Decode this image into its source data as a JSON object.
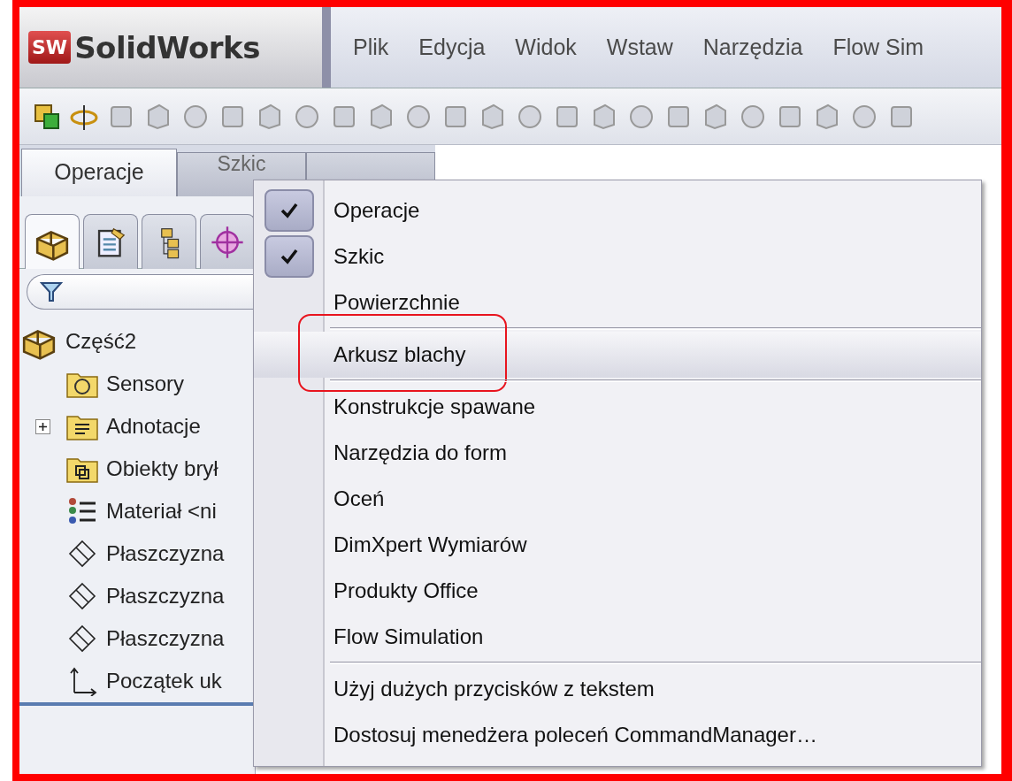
{
  "title_bar": {
    "logo_badge": "SW",
    "logo": "SolidWorks"
  },
  "menu_bar": [
    "Plik",
    "Edycja",
    "Widok",
    "Wstaw",
    "Narzędzia",
    "Flow Sim"
  ],
  "command_tabs": [
    {
      "label": "Operacje",
      "selected": true
    },
    {
      "label": "Szkic",
      "selected": false
    }
  ],
  "panel_tabs": [
    {
      "kind": "feature-tree",
      "selected": true
    },
    {
      "kind": "properties",
      "selected": false
    },
    {
      "kind": "configurations",
      "selected": false
    },
    {
      "kind": "display",
      "selected": false
    }
  ],
  "tree": {
    "label": "Część2",
    "children": [
      {
        "label": "Sensory",
        "kind": "sensor-folder"
      },
      {
        "label": "Adnotacje",
        "kind": "annotation-folder",
        "expanded": false
      },
      {
        "label": "Obiekty brył",
        "kind": "body-folder"
      },
      {
        "label": "Materiał <ni",
        "kind": "material"
      },
      {
        "label": "Płaszczyzna",
        "kind": "plane"
      },
      {
        "label": "Płaszczyzna",
        "kind": "plane"
      },
      {
        "label": "Płaszczyzna",
        "kind": "plane"
      },
      {
        "label": "Początek uk",
        "kind": "origin"
      }
    ]
  },
  "context_menu": {
    "items": [
      {
        "kind": "item",
        "label": "Operacje",
        "checked": true,
        "selected": false,
        "annotated": false
      },
      {
        "kind": "item",
        "label": "Szkic",
        "checked": true,
        "selected": false,
        "annotated": false
      },
      {
        "kind": "item",
        "label": "Powierzchnie",
        "checked": false,
        "selected": false,
        "annotated": false
      },
      {
        "kind": "separator"
      },
      {
        "kind": "item",
        "label": "Arkusz blachy",
        "checked": false,
        "selected": true,
        "annotated": true
      },
      {
        "kind": "separator"
      },
      {
        "kind": "item",
        "label": "Konstrukcje spawane",
        "checked": false,
        "selected": false,
        "annotated": false
      },
      {
        "kind": "item",
        "label": "Narzędzia do form",
        "checked": false,
        "selected": false,
        "annotated": false
      },
      {
        "kind": "item",
        "label": "Oceń",
        "checked": false,
        "selected": false,
        "annotated": false
      },
      {
        "kind": "item",
        "label": "DimXpert Wymiarów",
        "checked": false,
        "selected": false,
        "annotated": false
      },
      {
        "kind": "item",
        "label": "Produkty Office",
        "checked": false,
        "selected": false,
        "annotated": false
      },
      {
        "kind": "item",
        "label": "Flow Simulation",
        "checked": false,
        "selected": false,
        "annotated": false
      },
      {
        "kind": "separator"
      },
      {
        "kind": "item",
        "label": "Użyj dużych przycisków z tekstem",
        "checked": false,
        "selected": false,
        "annotated": false
      },
      {
        "kind": "item",
        "label": "Dostosuj menedżera poleceń CommandManager…",
        "checked": false,
        "selected": false,
        "annotated": false
      }
    ]
  }
}
